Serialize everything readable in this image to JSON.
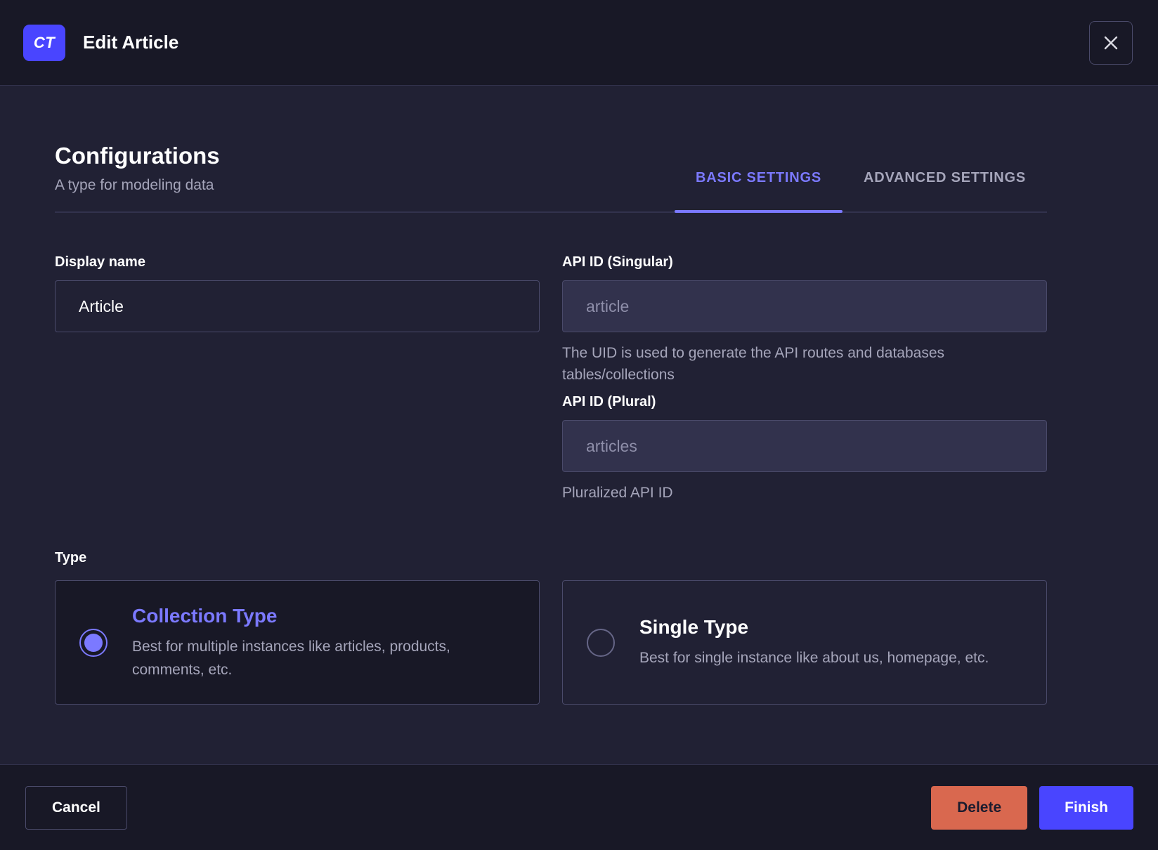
{
  "header": {
    "badge": "CT",
    "title": "Edit Article"
  },
  "config": {
    "title": "Configurations",
    "subtitle": "A type for modeling data",
    "tabs": [
      {
        "label": "BASIC SETTINGS",
        "active": true
      },
      {
        "label": "ADVANCED SETTINGS",
        "active": false
      }
    ]
  },
  "form": {
    "display_name": {
      "label": "Display name",
      "value": "Article"
    },
    "api_id_singular": {
      "label": "API ID (Singular)",
      "placeholder": "article",
      "hint": "The UID is used to generate the API routes and databases tables/collections"
    },
    "api_id_plural": {
      "label": "API ID (Plural)",
      "placeholder": "articles",
      "hint": "Pluralized API ID"
    },
    "type": {
      "label": "Type",
      "options": [
        {
          "title": "Collection Type",
          "description": "Best for multiple instances like articles, products, comments, etc.",
          "selected": true
        },
        {
          "title": "Single Type",
          "description": "Best for single instance like about us, homepage, etc.",
          "selected": false
        }
      ]
    }
  },
  "footer": {
    "cancel": "Cancel",
    "delete": "Delete",
    "finish": "Finish"
  },
  "colors": {
    "primary": "#4945ff",
    "primary_light": "#7b79ff",
    "danger": "#d9684f",
    "surface_dark": "#181826",
    "surface": "#212134",
    "border": "#4a4a6a",
    "text_muted": "#a5a5ba"
  }
}
